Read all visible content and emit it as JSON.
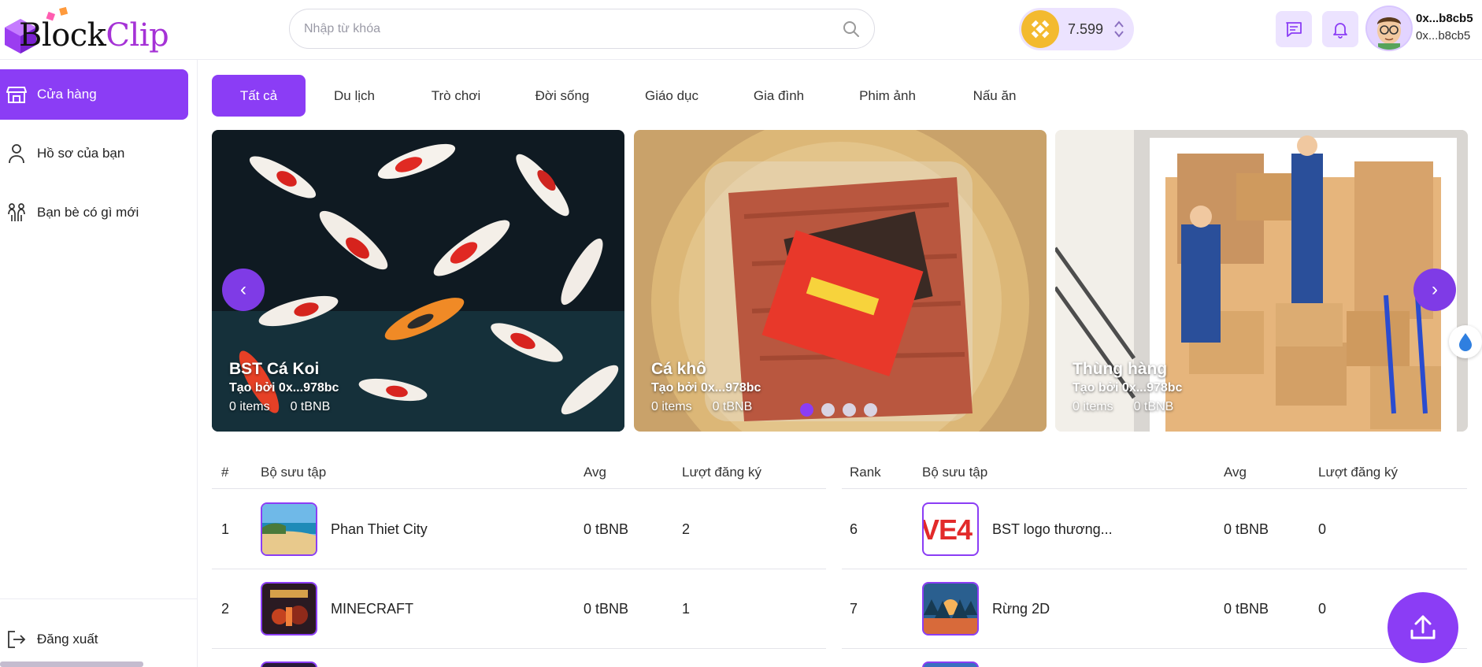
{
  "app": {
    "logo_part1": "Bl",
    "logo_part2": "ock",
    "logo_part3": "Clip",
    "brand_color": "#8b3df5"
  },
  "header": {
    "search_placeholder": "Nhập từ khóa",
    "balance": "7.599",
    "wallet_short": "0x...b8cb5",
    "wallet_sub": "0x...b8cb5"
  },
  "sidebar": {
    "items": [
      {
        "label": "Cửa hàng",
        "icon": "store-icon"
      },
      {
        "label": "Hồ sơ của bạn",
        "icon": "user-icon"
      },
      {
        "label": "Bạn bè có gì mới",
        "icon": "friends-icon"
      }
    ],
    "logout": "Đăng xuất"
  },
  "tabs": [
    "Tất cả",
    "Du lịch",
    "Trò chơi",
    "Đời sống",
    "Giáo dục",
    "Gia đình",
    "Phim ảnh",
    "Nấu ăn"
  ],
  "carousel": {
    "slides": [
      {
        "title": "BST Cá Koi",
        "creator": "Tạo bởi 0x...978bc",
        "items": "0 items",
        "price": "0 tBNB"
      },
      {
        "title": "Cá khô",
        "creator": "Tạo bởi 0x...978bc",
        "items": "0 items",
        "price": "0 tBNB"
      },
      {
        "title": "Thùng hàng",
        "creator": "Tạo bởi 0x...978bc",
        "items": "0 items",
        "price": "0 tBNB"
      }
    ],
    "prev": "‹",
    "next": "›"
  },
  "table_left": {
    "headers": [
      "#",
      "Bộ sưu tập",
      "Avg",
      "Lượt đăng ký"
    ],
    "rows": [
      {
        "rank": "1",
        "name": "Phan Thiet City",
        "avg": "0 tBNB",
        "subs": "2"
      },
      {
        "rank": "2",
        "name": "MINECRAFT",
        "avg": "0 tBNB",
        "subs": "1"
      }
    ]
  },
  "table_right": {
    "headers": [
      "Rank",
      "Bộ sưu tập",
      "Avg",
      "Lượt đăng ký"
    ],
    "rows": [
      {
        "rank": "6",
        "name": "BST logo thương...",
        "avg": "0 tBNB",
        "subs": "0",
        "thumb_text": "VE4"
      },
      {
        "rank": "7",
        "name": "Rừng 2D",
        "avg": "0 tBNB",
        "subs": "0"
      }
    ]
  }
}
